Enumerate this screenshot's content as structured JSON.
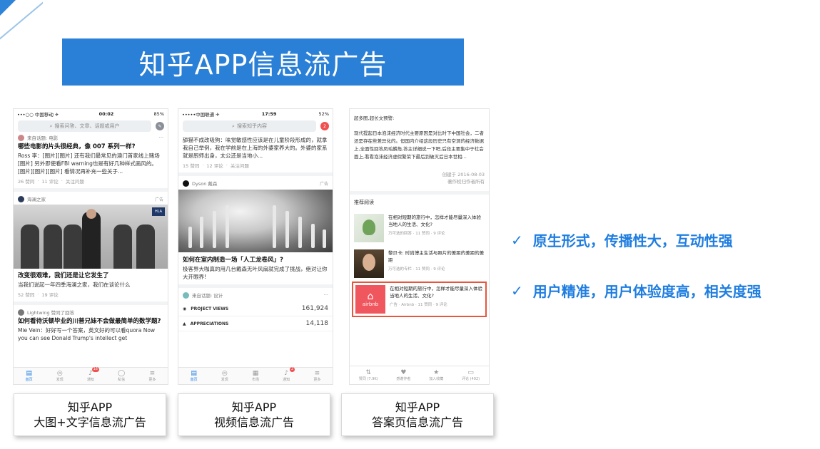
{
  "slide": {
    "title": "知乎APP信息流广告",
    "bullets": [
      "原生形式，传播性大，互动性强",
      "用户精准，用户体验度高，相关度强"
    ],
    "captions": [
      {
        "line1": "知乎APP",
        "line2": "大图+文字信息流广告"
      },
      {
        "line1": "知乎APP",
        "line2": "视频信息流广告"
      },
      {
        "line1": "知乎APP",
        "line2": "答案页信息流广告"
      }
    ]
  },
  "phone1": {
    "status": {
      "carrier": "•••○○ 中国移动 ✈",
      "time": "00:02",
      "battery": "85%"
    },
    "search_placeholder": "搜索问答、文章、话题或用户",
    "items": [
      {
        "source": "来自话题: 电影",
        "title": "哪些电影的片头很经典，像 007 系列一样?",
        "body": "Ross 李：[图片][图片] 还有我们最常见的澳门首家线上赌场 [图片] 另外即使看FBI warning也是有好几种样式画风的。[图片][图片][图片] 看情况再补充一些关于...",
        "meta": [
          "26 赞同",
          "11 评论",
          "关注问题"
        ]
      },
      {
        "source": "海澜之家",
        "tag": "广告",
        "badge": "HLA",
        "title": "改变很艰难，我们还是让它发生了",
        "body": "当我们说起一年四季海澜之家，我们在谈论什么",
        "meta": [
          "52 赞同",
          "19 评论"
        ]
      },
      {
        "source": "Lightwing 赞同了回答",
        "title": "如何看待沃顿毕业的川普兄妹不会做最简单的数学题?",
        "body": "Mie Vein：好好写一个答案，英文好的可以看quora Now you can see Donald Trump's intellect get"
      }
    ],
    "tabs": [
      {
        "label": "首页",
        "badge": ""
      },
      {
        "label": "发现",
        "badge": ""
      },
      {
        "label": "通知",
        "badge": "16"
      },
      {
        "label": "私信",
        "badge": ""
      },
      {
        "label": "更多",
        "badge": ""
      }
    ]
  },
  "phone2": {
    "status": {
      "carrier": "•••••中国联通 ✈",
      "time": "17:59",
      "battery": "52%"
    },
    "search_placeholder": "搜索知乎内容",
    "search_badge": "2",
    "items": [
      {
        "body": "舔猫不成改吸狗：味觉敏感性应该是在儿童阶段形成的，就拿我自己举例，我在学前是在上海的外婆家养大的。外婆的家系就是厨师出身，太公还是当地小...",
        "meta": [
          "15 赞同",
          "12 评论",
          "关注问题"
        ]
      },
      {
        "source": "Dyson 戴森",
        "tag": "广告",
        "title": "如何在室内制造一场「人工龙卷风」?",
        "body": "极客界大咖真的用几台戴森无叶风扇就完成了挑战，绝对让你大开眼界!"
      },
      {
        "source": "来自话题: 设计"
      }
    ],
    "stats": [
      {
        "label": "PROJECT VIEWS",
        "value": "161,924"
      },
      {
        "label": "APPRECIATIONS",
        "value": "14,118"
      }
    ],
    "tabs": [
      {
        "label": "首页",
        "badge": ""
      },
      {
        "label": "发现",
        "badge": ""
      },
      {
        "label": "市场",
        "badge": ""
      },
      {
        "label": "通知",
        "badge": "2"
      },
      {
        "label": "更多",
        "badge": ""
      }
    ]
  },
  "phone3": {
    "article": {
      "line1": "超多图,超长文预警:",
      "body": "现代提起日本泡沫经济时代主要原因是对比时下中国社会，二者还是存在些差异化的。但国内介绍这段历史只有空洞的经济数据上,全面性回答凤毛麟角,答主详细说一下吧,后段主要集中于社会面上,看看泡沫经济虚假繁荣下最后到破灭后日本世相...",
      "date": "创建于 2016-08-03",
      "copyright": "著作权归作者所有"
    },
    "rec_title": "推荐阅读",
    "recs": [
      {
        "text": "在相对短期的旅行中，怎样才能尽量深入体验当地人的生活、文化?",
        "meta": "万可选的回答 · 11 赞同 · 9 评论"
      },
      {
        "text": "黎贝卡: 时尚博主生活与照片的差距的差距的差距",
        "meta": "万可选的专栏 · 11 赞同 · 9 评论"
      },
      {
        "text": "在相对短期的旅行中，怎样才能尽量深入体验当地人的生活、文化?",
        "meta": "广告 · Airbnb · 11 赞同 · 9 评论",
        "brand": "airbnb"
      }
    ],
    "tabs": [
      {
        "label": "赞同 (7.9K)"
      },
      {
        "label": "感谢作者"
      },
      {
        "label": "加入收藏"
      },
      {
        "label": "评论 (492)"
      }
    ]
  },
  "colors": {
    "accent": "#2a7fd6",
    "highlight": "#e8553a",
    "airbnb": "#f0565d"
  }
}
